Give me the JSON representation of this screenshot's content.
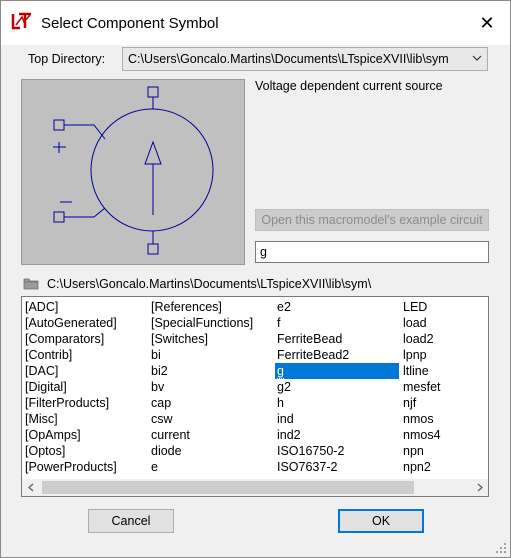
{
  "window": {
    "title": "Select Component Symbol",
    "app_icon": "ltspice-logo-icon",
    "close_glyph": "✕"
  },
  "top_directory": {
    "label": "Top Directory:",
    "value": "C:\\Users\\Goncalo.Martins\\Documents\\LTspiceXVII\\lib\\sym"
  },
  "preview": {
    "description": "Voltage dependent current source",
    "plus": "+",
    "minus": "−"
  },
  "macromodel_button": "Open this macromodel's example circuit",
  "name_input": "g",
  "current_path": "C:\\Users\\Goncalo.Martins\\Documents\\LTspiceXVII\\lib\\sym\\",
  "list": {
    "columns": [
      [
        "[ADC]",
        "[AutoGenerated]",
        "[Comparators]",
        "[Contrib]",
        "[DAC]",
        "[Digital]",
        "[FilterProducts]",
        "[Misc]",
        "[OpAmps]",
        "[Optos]",
        "[PowerProducts]"
      ],
      [
        "[References]",
        "[SpecialFunctions]",
        "[Switches]",
        "bi",
        "bi2",
        "bv",
        "cap",
        "csw",
        "current",
        "diode",
        "e"
      ],
      [
        "e2",
        "f",
        "FerriteBead",
        "FerriteBead2",
        "g",
        "g2",
        "h",
        "ind",
        "ind2",
        "ISO16750-2",
        "ISO7637-2"
      ],
      [
        "LED",
        "load",
        "load2",
        "lpnp",
        "ltline",
        "mesfet",
        "njf",
        "nmos",
        "nmos4",
        "npn",
        "npn2"
      ]
    ],
    "selected": "g"
  },
  "buttons": {
    "cancel": "Cancel",
    "ok": "OK"
  },
  "colors": {
    "selection": "#0078d7",
    "preview_bg": "#c0c0c0",
    "symbol_stroke": "#00009c"
  }
}
